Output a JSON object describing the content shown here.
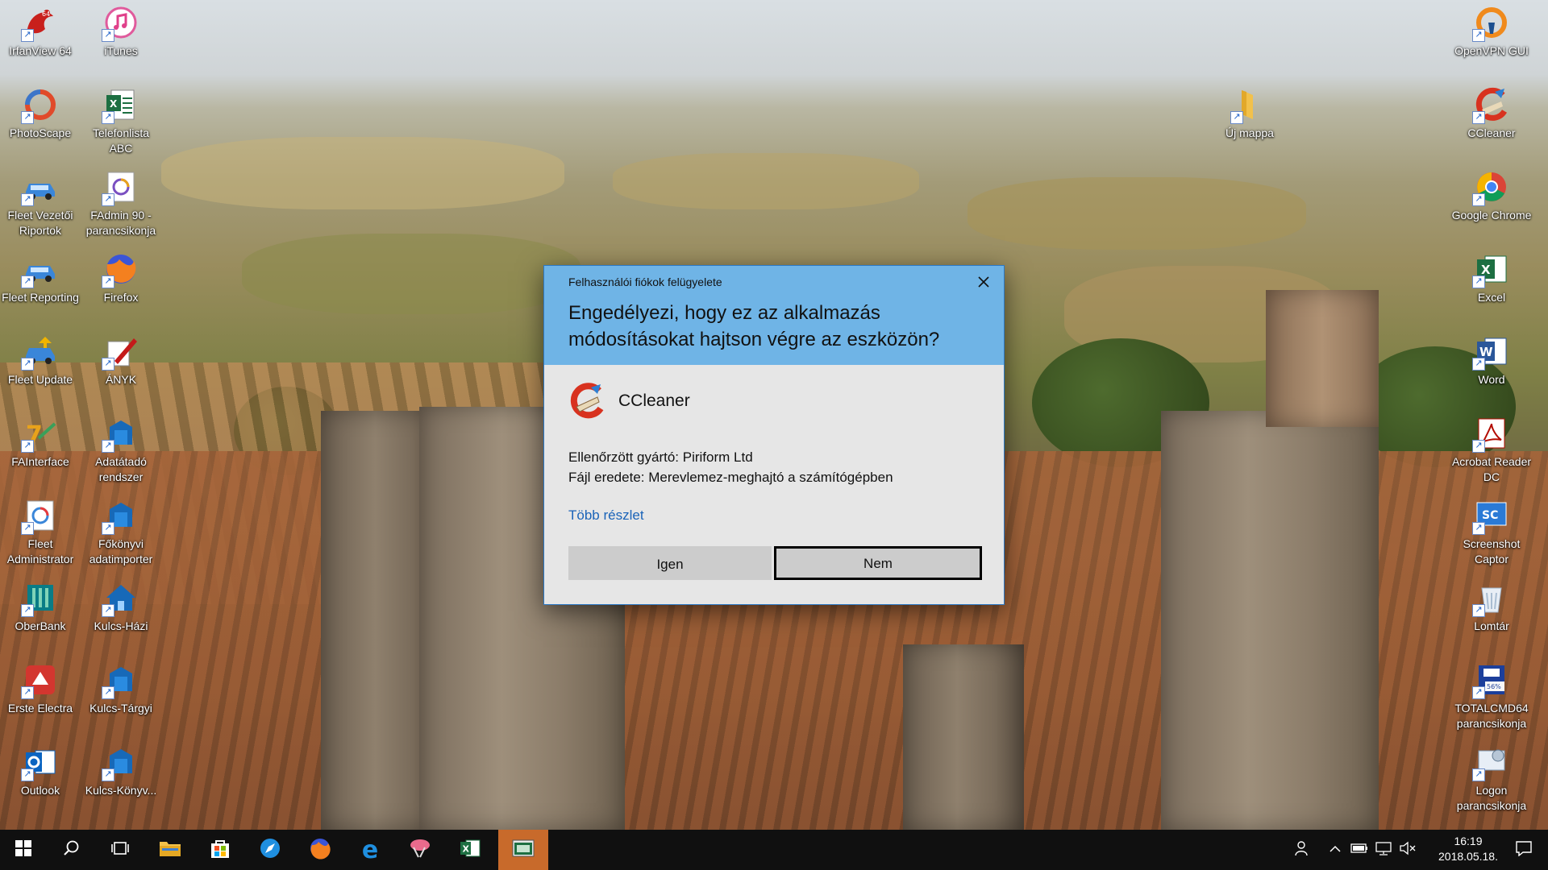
{
  "desktop": {
    "left_icons": [
      {
        "label": "IrfanView 64",
        "icon": "irfanview-icon"
      },
      {
        "label": "iTunes",
        "icon": "itunes-icon"
      },
      {
        "label": "PhotoScape",
        "icon": "photoscape-icon"
      },
      {
        "label": "Telefonlista ABC",
        "icon": "excel-file-icon"
      },
      {
        "label": "Fleet Vezetői Riportok",
        "icon": "fleet-car-icon"
      },
      {
        "label": "FAdmin 90 - parancsikonja",
        "icon": "fadmin-icon"
      },
      {
        "label": "Fleet Reporting",
        "icon": "fleet-car-icon"
      },
      {
        "label": "Firefox",
        "icon": "firefox-icon"
      },
      {
        "label": "Fleet Update",
        "icon": "fleet-update-icon"
      },
      {
        "label": "ÁNYK",
        "icon": "anyk-icon"
      },
      {
        "label": "FAInterface",
        "icon": "fainterface-icon"
      },
      {
        "label": "Adatátadó rendszer",
        "icon": "kulcs-icon"
      },
      {
        "label": "Fleet Administrator",
        "icon": "fleet-admin-icon"
      },
      {
        "label": "Főkönyvi adatimporter",
        "icon": "kulcs-icon"
      },
      {
        "label": "OberBank",
        "icon": "oberbank-icon"
      },
      {
        "label": "Kulcs-Házi",
        "icon": "kulcs-house-icon"
      },
      {
        "label": "Erste Electra",
        "icon": "erste-icon"
      },
      {
        "label": "Kulcs-Tárgyi",
        "icon": "kulcs-icon"
      },
      {
        "label": "Outlook",
        "icon": "outlook-icon"
      },
      {
        "label": "Kulcs-Könyv...",
        "icon": "kulcs-icon"
      }
    ],
    "right_icons": [
      {
        "label": "OpenVPN GUI",
        "icon": "openvpn-icon"
      },
      {
        "label": "Új mappa",
        "icon": "folder-icon"
      },
      {
        "label": "CCleaner",
        "icon": "ccleaner-icon"
      },
      {
        "label": "Google Chrome",
        "icon": "chrome-icon"
      },
      {
        "label": "Excel",
        "icon": "excel-icon"
      },
      {
        "label": "Word",
        "icon": "word-icon"
      },
      {
        "label": "Acrobat Reader DC",
        "icon": "acrobat-icon"
      },
      {
        "label": "Screenshot Captor",
        "icon": "screenshot-captor-icon"
      },
      {
        "label": "Lomtár",
        "icon": "recycle-bin-icon"
      },
      {
        "label": "TOTALCMD64 parancsikonja",
        "icon": "totalcmd-icon"
      },
      {
        "label": "Logon parancsikonja",
        "icon": "logon-icon"
      }
    ]
  },
  "uac": {
    "title": "Felhasználói fiókok felügyelete",
    "question": "Engedélyezi, hogy ez az alkalmazás módosításokat hajtson végre az eszközön?",
    "app_name": "CCleaner",
    "publisher": "Ellenőrzött gyártó: Piriform Ltd",
    "origin": "Fájl eredete: Merevlemez-meghajtó a számítógépben",
    "more_details": "Több részlet",
    "yes": "Igen",
    "no": "Nem",
    "header_color": "#6fb4e6",
    "link_color": "#1a63b8"
  },
  "taskbar": {
    "apps": [
      "start-icon",
      "search-icon",
      "task-view-icon",
      "file-explorer-icon",
      "store-icon",
      "safari-icon",
      "firefox-icon",
      "edge-icon",
      "snipping-icon",
      "excel-icon",
      "uac-window-icon"
    ],
    "active_color": "#c86a2b",
    "time": "16:19",
    "date": "2018.05.18."
  }
}
